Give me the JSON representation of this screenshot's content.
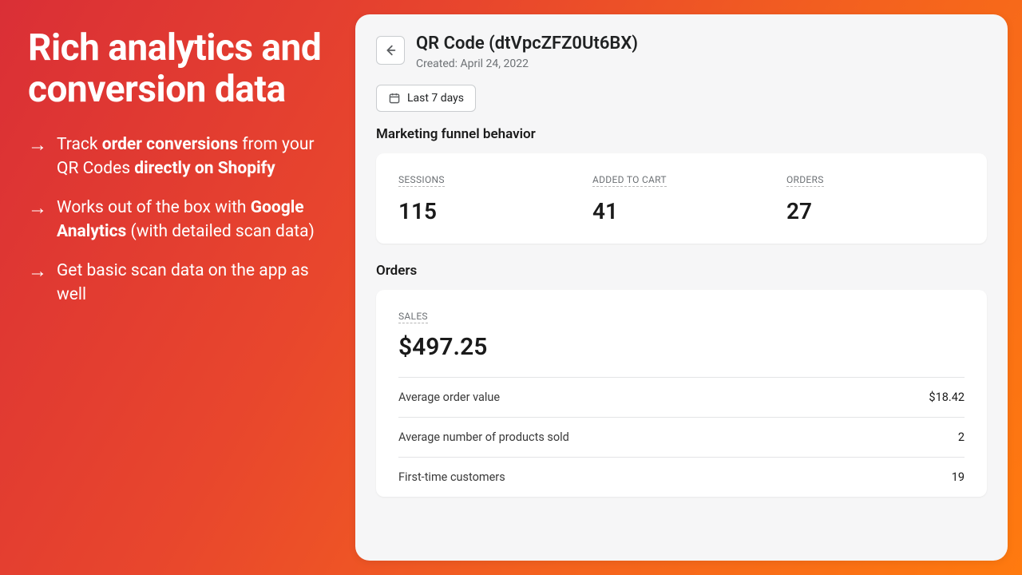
{
  "promo": {
    "heading": "Rich analytics and conversion data",
    "bullets": [
      {
        "pre": "Track ",
        "b1": "order conversions",
        "mid": " from your QR Codes ",
        "b2": "directly on Shopify",
        "post": ""
      },
      {
        "pre": "Works out of the box with ",
        "b1": "Google Analytics",
        "mid": " (with detailed scan data)",
        "b2": "",
        "post": ""
      },
      {
        "pre": "Get basic scan data on the app as well",
        "b1": "",
        "mid": "",
        "b2": "",
        "post": ""
      }
    ]
  },
  "header": {
    "title": "QR Code (dtVpcZFZ0Ut6BX)",
    "created": "Created: April 24, 2022"
  },
  "date_range": {
    "label": "Last 7 days"
  },
  "funnel": {
    "heading": "Marketing funnel behavior",
    "stats": [
      {
        "label": "SESSIONS",
        "value": "115"
      },
      {
        "label": "ADDED TO CART",
        "value": "41"
      },
      {
        "label": "ORDERS",
        "value": "27"
      }
    ]
  },
  "orders": {
    "heading": "Orders",
    "sales_label": "SALES",
    "sales_value": "$497.25",
    "metrics": [
      {
        "label": "Average order value",
        "value": "$18.42"
      },
      {
        "label": "Average number of products sold",
        "value": "2"
      },
      {
        "label": "First-time customers",
        "value": "19"
      }
    ]
  }
}
